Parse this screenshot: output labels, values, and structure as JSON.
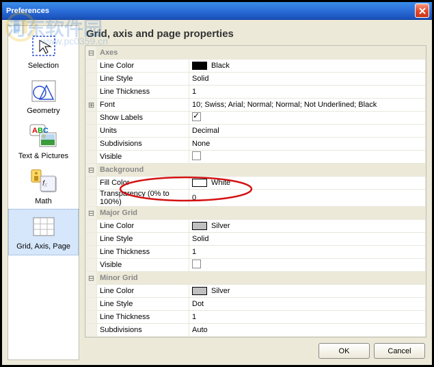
{
  "titlebar": {
    "title": "Preferences"
  },
  "watermark": {
    "main": "河东软件园",
    "sub": "www.pc0359.cn"
  },
  "categories": {
    "items": [
      {
        "label": "Selection"
      },
      {
        "label": "Geometry"
      },
      {
        "label": "Text & Pictures"
      },
      {
        "label": "Math"
      },
      {
        "label": "Grid, Axis, Page"
      }
    ]
  },
  "heading": "Grid, axis and page properties",
  "groups": {
    "axes": {
      "title": "Axes",
      "line_color": {
        "label": "Line Color",
        "value": "Black",
        "swatch": "#000000"
      },
      "line_style": {
        "label": "Line Style",
        "value": "Solid"
      },
      "line_thickness": {
        "label": "Line Thickness",
        "value": "1"
      },
      "font": {
        "label": "Font",
        "value": "10; Swiss; Arial; Normal; Normal; Not Underlined; Black"
      },
      "show_labels": {
        "label": "Show Labels",
        "checked": true
      },
      "units": {
        "label": "Units",
        "value": "Decimal"
      },
      "subdivisions": {
        "label": "Subdivisions",
        "value": "None"
      },
      "visible": {
        "label": "Visible",
        "checked": false
      }
    },
    "background": {
      "title": "Background",
      "fill_color": {
        "label": "Fill Color",
        "value": "White",
        "swatch": "#ffffff"
      },
      "transparency": {
        "label": "Transparency (0% to 100%)",
        "value": "0"
      }
    },
    "major": {
      "title": "Major Grid",
      "line_color": {
        "label": "Line Color",
        "value": "Silver",
        "swatch": "#c0c0c0"
      },
      "line_style": {
        "label": "Line Style",
        "value": "Solid"
      },
      "line_thickness": {
        "label": "Line Thickness",
        "value": "1"
      },
      "visible": {
        "label": "Visible",
        "checked": false
      }
    },
    "minor": {
      "title": "Minor Grid",
      "line_color": {
        "label": "Line Color",
        "value": "Silver",
        "swatch": "#c0c0c0"
      },
      "line_style": {
        "label": "Line Style",
        "value": "Dot"
      },
      "line_thickness": {
        "label": "Line Thickness",
        "value": "1"
      },
      "subdivisions": {
        "label": "Subdivisions",
        "value": "Auto"
      }
    }
  },
  "buttons": {
    "ok": "OK",
    "cancel": "Cancel"
  }
}
